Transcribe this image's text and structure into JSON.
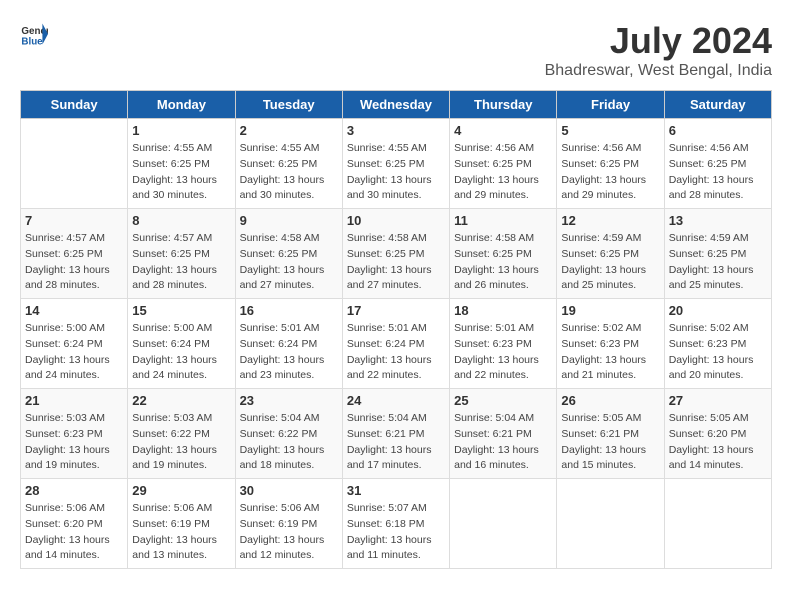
{
  "logo": {
    "text_general": "General",
    "text_blue": "Blue"
  },
  "title": "July 2024",
  "subtitle": "Bhadreswar, West Bengal, India",
  "days_of_week": [
    "Sunday",
    "Monday",
    "Tuesday",
    "Wednesday",
    "Thursday",
    "Friday",
    "Saturday"
  ],
  "weeks": [
    [
      {
        "day": "",
        "info": ""
      },
      {
        "day": "1",
        "info": "Sunrise: 4:55 AM\nSunset: 6:25 PM\nDaylight: 13 hours\nand 30 minutes."
      },
      {
        "day": "2",
        "info": "Sunrise: 4:55 AM\nSunset: 6:25 PM\nDaylight: 13 hours\nand 30 minutes."
      },
      {
        "day": "3",
        "info": "Sunrise: 4:55 AM\nSunset: 6:25 PM\nDaylight: 13 hours\nand 30 minutes."
      },
      {
        "day": "4",
        "info": "Sunrise: 4:56 AM\nSunset: 6:25 PM\nDaylight: 13 hours\nand 29 minutes."
      },
      {
        "day": "5",
        "info": "Sunrise: 4:56 AM\nSunset: 6:25 PM\nDaylight: 13 hours\nand 29 minutes."
      },
      {
        "day": "6",
        "info": "Sunrise: 4:56 AM\nSunset: 6:25 PM\nDaylight: 13 hours\nand 28 minutes."
      }
    ],
    [
      {
        "day": "7",
        "info": "Sunrise: 4:57 AM\nSunset: 6:25 PM\nDaylight: 13 hours\nand 28 minutes."
      },
      {
        "day": "8",
        "info": "Sunrise: 4:57 AM\nSunset: 6:25 PM\nDaylight: 13 hours\nand 28 minutes."
      },
      {
        "day": "9",
        "info": "Sunrise: 4:58 AM\nSunset: 6:25 PM\nDaylight: 13 hours\nand 27 minutes."
      },
      {
        "day": "10",
        "info": "Sunrise: 4:58 AM\nSunset: 6:25 PM\nDaylight: 13 hours\nand 27 minutes."
      },
      {
        "day": "11",
        "info": "Sunrise: 4:58 AM\nSunset: 6:25 PM\nDaylight: 13 hours\nand 26 minutes."
      },
      {
        "day": "12",
        "info": "Sunrise: 4:59 AM\nSunset: 6:25 PM\nDaylight: 13 hours\nand 25 minutes."
      },
      {
        "day": "13",
        "info": "Sunrise: 4:59 AM\nSunset: 6:25 PM\nDaylight: 13 hours\nand 25 minutes."
      }
    ],
    [
      {
        "day": "14",
        "info": "Sunrise: 5:00 AM\nSunset: 6:24 PM\nDaylight: 13 hours\nand 24 minutes."
      },
      {
        "day": "15",
        "info": "Sunrise: 5:00 AM\nSunset: 6:24 PM\nDaylight: 13 hours\nand 24 minutes."
      },
      {
        "day": "16",
        "info": "Sunrise: 5:01 AM\nSunset: 6:24 PM\nDaylight: 13 hours\nand 23 minutes."
      },
      {
        "day": "17",
        "info": "Sunrise: 5:01 AM\nSunset: 6:24 PM\nDaylight: 13 hours\nand 22 minutes."
      },
      {
        "day": "18",
        "info": "Sunrise: 5:01 AM\nSunset: 6:23 PM\nDaylight: 13 hours\nand 22 minutes."
      },
      {
        "day": "19",
        "info": "Sunrise: 5:02 AM\nSunset: 6:23 PM\nDaylight: 13 hours\nand 21 minutes."
      },
      {
        "day": "20",
        "info": "Sunrise: 5:02 AM\nSunset: 6:23 PM\nDaylight: 13 hours\nand 20 minutes."
      }
    ],
    [
      {
        "day": "21",
        "info": "Sunrise: 5:03 AM\nSunset: 6:23 PM\nDaylight: 13 hours\nand 19 minutes."
      },
      {
        "day": "22",
        "info": "Sunrise: 5:03 AM\nSunset: 6:22 PM\nDaylight: 13 hours\nand 19 minutes."
      },
      {
        "day": "23",
        "info": "Sunrise: 5:04 AM\nSunset: 6:22 PM\nDaylight: 13 hours\nand 18 minutes."
      },
      {
        "day": "24",
        "info": "Sunrise: 5:04 AM\nSunset: 6:21 PM\nDaylight: 13 hours\nand 17 minutes."
      },
      {
        "day": "25",
        "info": "Sunrise: 5:04 AM\nSunset: 6:21 PM\nDaylight: 13 hours\nand 16 minutes."
      },
      {
        "day": "26",
        "info": "Sunrise: 5:05 AM\nSunset: 6:21 PM\nDaylight: 13 hours\nand 15 minutes."
      },
      {
        "day": "27",
        "info": "Sunrise: 5:05 AM\nSunset: 6:20 PM\nDaylight: 13 hours\nand 14 minutes."
      }
    ],
    [
      {
        "day": "28",
        "info": "Sunrise: 5:06 AM\nSunset: 6:20 PM\nDaylight: 13 hours\nand 14 minutes."
      },
      {
        "day": "29",
        "info": "Sunrise: 5:06 AM\nSunset: 6:19 PM\nDaylight: 13 hours\nand 13 minutes."
      },
      {
        "day": "30",
        "info": "Sunrise: 5:06 AM\nSunset: 6:19 PM\nDaylight: 13 hours\nand 12 minutes."
      },
      {
        "day": "31",
        "info": "Sunrise: 5:07 AM\nSunset: 6:18 PM\nDaylight: 13 hours\nand 11 minutes."
      },
      {
        "day": "",
        "info": ""
      },
      {
        "day": "",
        "info": ""
      },
      {
        "day": "",
        "info": ""
      }
    ]
  ]
}
